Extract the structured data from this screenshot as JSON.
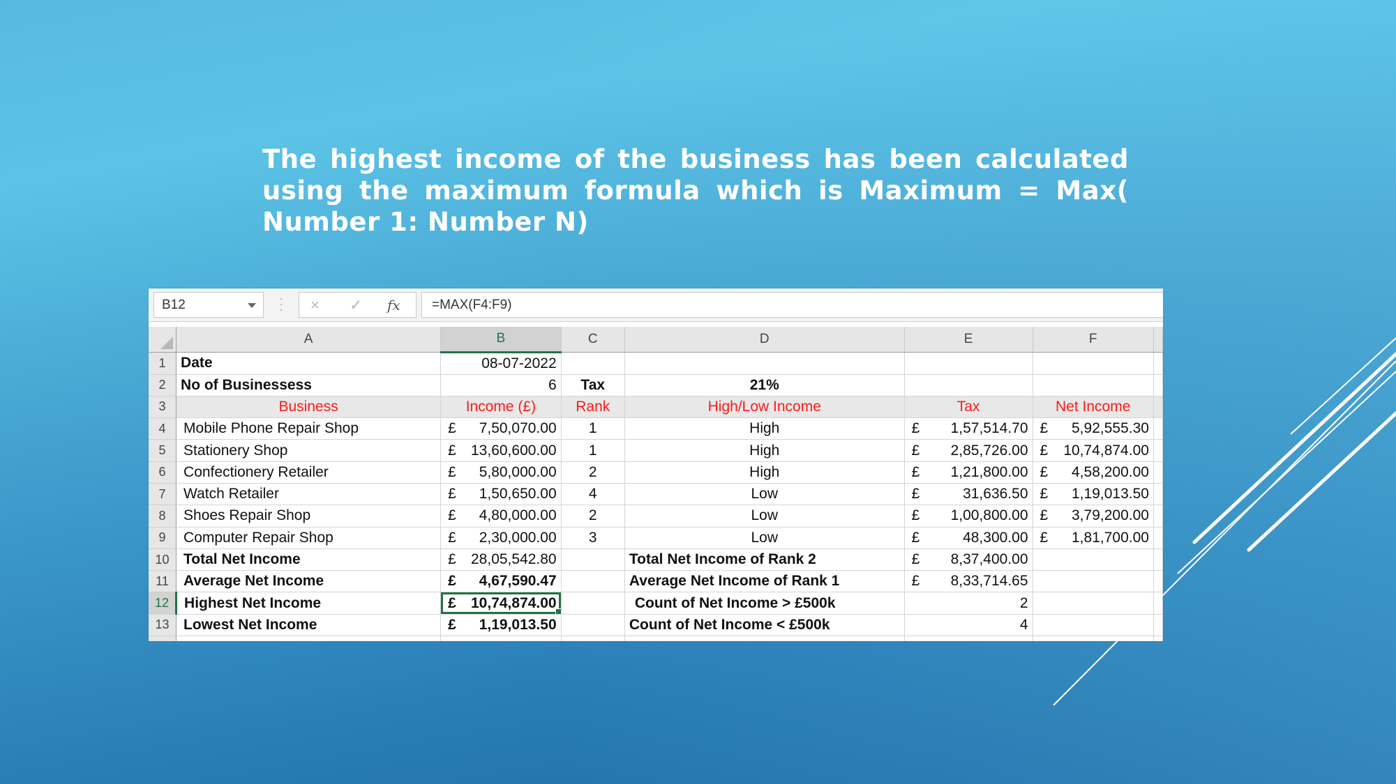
{
  "slide": {
    "caption": "The highest income of the business has been calculated using the maximum formula which is Maximum = Max( Number 1: Number N)",
    "colors": {
      "bg_top": "#58b9de",
      "bg_bottom": "#1b69a5",
      "header_red": "#ff1a1a",
      "excel_green": "#217346"
    }
  },
  "formula_bar": {
    "name_box": "B12",
    "cancel_icon": "×",
    "enter_icon": "✓",
    "fx_icon": "fx",
    "formula": "=MAX(F4:F9)"
  },
  "columns": [
    "A",
    "B",
    "C",
    "D",
    "E",
    "F"
  ],
  "selected_column": "B",
  "selected_row": "12",
  "rows": [
    {
      "num": "1",
      "A": "Date",
      "B": "08-07-2022",
      "C": "",
      "D": "",
      "E": "",
      "F": ""
    },
    {
      "num": "2",
      "A": "No of Businessess",
      "B": "6",
      "C": "Tax",
      "D": "21%",
      "E": "",
      "F": ""
    },
    {
      "num": "3",
      "A": "Business",
      "B": "Income (£)",
      "C": "Rank",
      "D": "High/Low Income",
      "E": "Tax",
      "F": "Net Income"
    },
    {
      "num": "4",
      "A": "Mobile Phone Repair Shop",
      "B_cur": "£",
      "B": "7,50,070.00",
      "C": "1",
      "D": "High",
      "E_cur": "£",
      "E": "1,57,514.70",
      "F_cur": "£",
      "F": "5,92,555.30"
    },
    {
      "num": "5",
      "A": "Stationery Shop",
      "B_cur": "£",
      "B": "13,60,600.00",
      "C": "1",
      "D": "High",
      "E_cur": "£",
      "E": "2,85,726.00",
      "F_cur": "£",
      "F": "10,74,874.00"
    },
    {
      "num": "6",
      "A": "Confectionery Retailer",
      "B_cur": "£",
      "B": "5,80,000.00",
      "C": "2",
      "D": "High",
      "E_cur": "£",
      "E": "1,21,800.00",
      "F_cur": "£",
      "F": "4,58,200.00"
    },
    {
      "num": "7",
      "A": "Watch Retailer",
      "B_cur": "£",
      "B": "1,50,650.00",
      "C": "4",
      "D": "Low",
      "E_cur": "£",
      "E": "31,636.50",
      "F_cur": "£",
      "F": "1,19,013.50"
    },
    {
      "num": "8",
      "A": "Shoes Repair Shop",
      "B_cur": "£",
      "B": "4,80,000.00",
      "C": "2",
      "D": "Low",
      "E_cur": "£",
      "E": "1,00,800.00",
      "F_cur": "£",
      "F": "3,79,200.00"
    },
    {
      "num": "9",
      "A": "Computer Repair Shop",
      "B_cur": "£",
      "B": "2,30,000.00",
      "C": "3",
      "D": "Low",
      "E_cur": "£",
      "E": "48,300.00",
      "F_cur": "£",
      "F": "1,81,700.00"
    },
    {
      "num": "10",
      "A": "Total Net Income",
      "B_cur": "£",
      "B": "28,05,542.80",
      "C": "",
      "D": "Total Net Income of Rank 2",
      "E_cur": "£",
      "E": "8,37,400.00",
      "F": ""
    },
    {
      "num": "11",
      "A": "Average Net Income",
      "B_cur": "£",
      "B": "4,67,590.47",
      "C": "",
      "D": "Average Net Income of Rank 1",
      "E_cur": "£",
      "E": "8,33,714.65",
      "F": ""
    },
    {
      "num": "12",
      "A": "Highest Net Income",
      "B_cur": "£",
      "B": "10,74,874.00",
      "C": "",
      "D": "Count of Net Income > £500k",
      "E": "2",
      "F": ""
    },
    {
      "num": "13",
      "A": "Lowest Net Income",
      "B_cur": "£",
      "B": "1,19,013.50",
      "C": "",
      "D": "Count of Net Income < £500k",
      "E": "4",
      "F": ""
    }
  ]
}
